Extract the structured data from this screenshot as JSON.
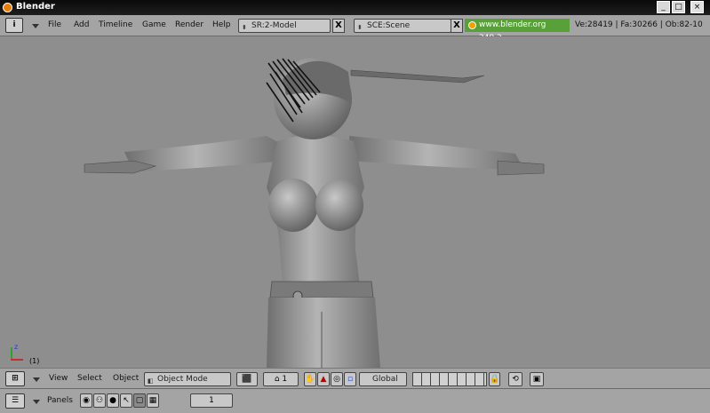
{
  "window": {
    "title": "Blender",
    "min": "_",
    "max": "□",
    "close": "×"
  },
  "info_header": {
    "icon": "i",
    "menus": [
      "File",
      "Add",
      "Timeline",
      "Game",
      "Render",
      "Help"
    ],
    "screen_field": "SR:2-Model",
    "scene_field": "SCE:Scene",
    "close_x": "X",
    "website": "www.blender.org 249.2",
    "stats": "Ve:28419 | Fa:30266 | Ob:82-10"
  },
  "viewport": {
    "frame_label": "(1)",
    "axis_z": "z"
  },
  "view3d_header": {
    "menus": [
      "View",
      "Select",
      "Object"
    ],
    "mode": "Object Mode",
    "layer_value": "1",
    "orientation": "Global"
  },
  "buttons_header": {
    "panels_label": "Panels",
    "frame_value": "1"
  },
  "colors": {
    "viewport_bg": "#8e8e8e",
    "header_bg": "#a4a4a4",
    "website_bg": "#58a038"
  }
}
